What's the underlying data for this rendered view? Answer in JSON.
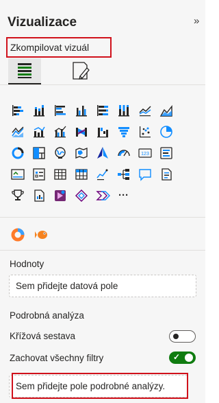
{
  "pane": {
    "title": "Vizualizace",
    "collapse_icon": "»",
    "subtitle": "Zkompilovat vizuál",
    "tabs": [
      {
        "name": "build-visual-icon",
        "selected": true
      },
      {
        "name": "format-visual-icon",
        "selected": false
      }
    ]
  },
  "visuals": {
    "rows": [
      [
        "stacked-bar-chart-icon",
        "stacked-column-chart-icon",
        "clustered-bar-chart-icon",
        "clustered-column-chart-icon",
        "100-stacked-bar-chart-icon",
        "100-stacked-column-chart-icon",
        "line-chart-icon",
        "area-chart-icon"
      ],
      [
        "stacked-area-chart-icon",
        "line-and-stacked-column-icon",
        "line-and-clustered-column-icon",
        "ribbon-chart-icon",
        "waterfall-chart-icon",
        "funnel-icon",
        "scatter-chart-icon",
        "pie-chart-icon"
      ],
      [
        "donut-chart-icon",
        "treemap-icon",
        "map-icon",
        "filled-map-icon",
        "azure-map-icon",
        "gauge-icon",
        "card-icon",
        "multi-row-card-icon"
      ],
      [
        "kpi-icon",
        "slicer-icon",
        "table-icon",
        "matrix-icon",
        "r-visual-icon",
        "decomposition-tree-icon",
        "qa-icon",
        "smart-narrative-icon"
      ],
      [
        "key-influencers-icon",
        "paginated-report-icon",
        "power-apps-icon",
        "power-automate-icon",
        "metrics-icon",
        "more-visuals-icon"
      ]
    ],
    "more_label": "···"
  },
  "custom_visuals": [
    "custom-visual-donut-icon",
    "custom-visual-fish-icon"
  ],
  "fields": {
    "values_label": "Hodnoty",
    "values_placeholder": "Sem přidejte datová pole",
    "drillthrough_label": "Podrobná analýza",
    "cross_report_label": "Křížová sestava",
    "cross_report_on": false,
    "keep_filters_label": "Zachovat všechny filtry",
    "keep_filters_on": true,
    "drillthrough_placeholder": "Sem přidejte pole podrobné analýzy."
  },
  "colors": {
    "accent": "#118dff",
    "highlight_box": "#d0111b",
    "toggle_on": "#107c10"
  }
}
